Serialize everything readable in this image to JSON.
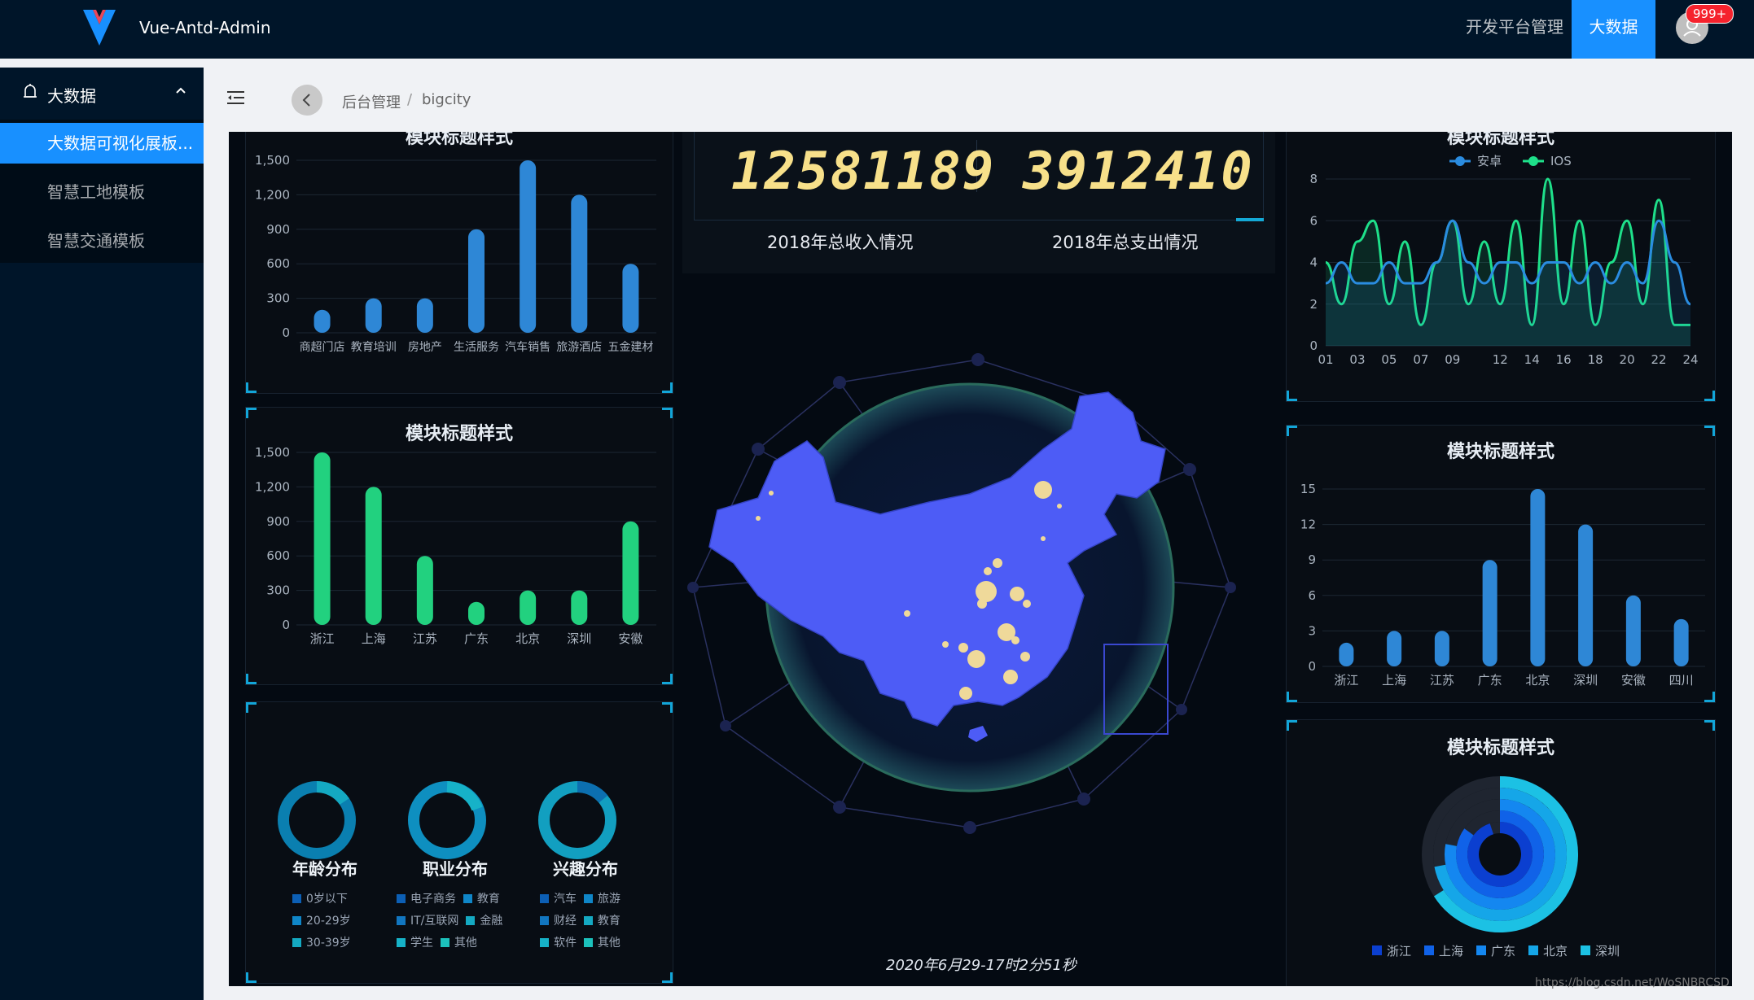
{
  "header": {
    "app_title": "Vue-Antd-Admin",
    "nav": [
      "开发平台管理",
      "大数据"
    ],
    "badge": "999+"
  },
  "sidebar": {
    "group_label": "大数据",
    "items": [
      {
        "label": "大数据可视化展板..."
      },
      {
        "label": "智慧工地模板"
      },
      {
        "label": "智慧交通模板"
      }
    ]
  },
  "breadcrumb": {
    "items": [
      "后台管理",
      "bigcity"
    ],
    "separator": "/"
  },
  "dashboard": {
    "income_value": "12581189",
    "expense_value": "3912410",
    "income_caption": "2018年总收入情况",
    "expense_caption": "2018年总支出情况",
    "timestamp": "2020年6月29-17时2分51秒",
    "donut_titles": [
      "年龄分布",
      "职业分布",
      "兴趣分布"
    ],
    "donut_legends": [
      [
        "0岁以下",
        "20-29岁",
        "30-39岁"
      ],
      [
        "电子商务",
        "教育",
        "IT/互联网",
        "金融",
        "学生",
        "其他"
      ],
      [
        "汽车",
        "旅游",
        "财经",
        "教育",
        "软件",
        "其他"
      ]
    ],
    "watermark": "https://blog.csdn.net/WoSNBRCSD"
  },
  "colors": {
    "blue_bar": "#2e87d6",
    "green_bar": "#22d17f",
    "map": "#4d5cf6",
    "accent": "#1890ff"
  },
  "chart_data": [
    {
      "type": "bar",
      "title": "模块标题样式",
      "categories": [
        "商超门店",
        "教育培训",
        "房地产",
        "生活服务",
        "汽车销售",
        "旅游酒店",
        "五金建材"
      ],
      "values": [
        200,
        300,
        300,
        900,
        1500,
        1200,
        600
      ],
      "ylim": [
        0,
        1500
      ],
      "yticks": [
        "0",
        "300",
        "600",
        "900",
        "1,200",
        "1,500"
      ],
      "color": "#2e87d6"
    },
    {
      "type": "bar",
      "title": "模块标题样式",
      "categories": [
        "浙江",
        "上海",
        "江苏",
        "广东",
        "北京",
        "深圳",
        "安徽"
      ],
      "values": [
        1500,
        1200,
        600,
        200,
        300,
        300,
        900
      ],
      "ylim": [
        0,
        1500
      ],
      "yticks": [
        "0",
        "300",
        "600",
        "900",
        "1,200",
        "1,500"
      ],
      "color": "#22d17f"
    },
    {
      "type": "line",
      "title": "模块标题样式",
      "x": [
        "01",
        "02",
        "03",
        "04",
        "05",
        "06",
        "07",
        "08",
        "09",
        "10",
        "11",
        "12",
        "13",
        "14",
        "15",
        "16",
        "17",
        "18",
        "19",
        "20",
        "21",
        "22",
        "23",
        "24"
      ],
      "xticks": [
        "01",
        "03",
        "05",
        "07",
        "09",
        "12",
        "14",
        "16",
        "18",
        "20",
        "22",
        "24"
      ],
      "ylim": [
        0,
        8
      ],
      "yticks": [
        "0",
        "2",
        "4",
        "6",
        "8"
      ],
      "legend": "top",
      "series": [
        {
          "name": "安卓",
          "values": [
            3,
            4,
            3,
            3,
            4,
            3,
            3,
            4,
            6,
            4,
            3,
            4,
            4,
            3,
            4,
            4,
            3,
            4,
            3,
            4,
            3,
            6,
            4,
            2
          ],
          "color": "#2a8ce0"
        },
        {
          "name": "IOS",
          "values": [
            4,
            2,
            5,
            6,
            2,
            5,
            1,
            4,
            6,
            2,
            5,
            2,
            6,
            1,
            8,
            2,
            6,
            1,
            4,
            6,
            2,
            7,
            1,
            1
          ],
          "color": "#1ee08a"
        }
      ]
    },
    {
      "type": "bar",
      "title": "模块标题样式",
      "categories": [
        "浙江",
        "上海",
        "江苏",
        "广东",
        "北京",
        "深圳",
        "安徽",
        "四川"
      ],
      "values": [
        2,
        3,
        3,
        9,
        15,
        12,
        6,
        4
      ],
      "ylim": [
        0,
        15
      ],
      "yticks": [
        "0",
        "3",
        "6",
        "9",
        "12",
        "15"
      ],
      "color": "#2e87d6"
    },
    {
      "type": "pie",
      "title": "模块标题样式",
      "categories": [
        "浙江",
        "上海",
        "广东",
        "北京",
        "深圳"
      ],
      "values": [
        0.95,
        0.85,
        0.78,
        0.72,
        0.66
      ],
      "colors": [
        "#0b3fd0",
        "#1062e8",
        "#1487f0",
        "#15a6e8",
        "#1cc1e4"
      ]
    }
  ]
}
